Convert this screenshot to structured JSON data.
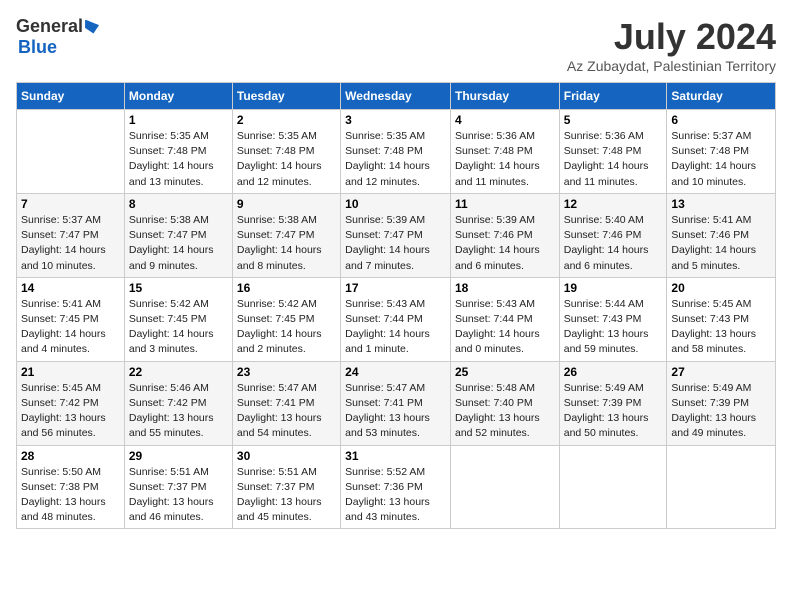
{
  "header": {
    "logo_general": "General",
    "logo_blue": "Blue",
    "month": "July 2024",
    "location": "Az Zubaydat, Palestinian Territory"
  },
  "weekdays": [
    "Sunday",
    "Monday",
    "Tuesday",
    "Wednesday",
    "Thursday",
    "Friday",
    "Saturday"
  ],
  "weeks": [
    [
      {
        "day": "",
        "sunrise": "",
        "sunset": "",
        "daylight": ""
      },
      {
        "day": "1",
        "sunrise": "Sunrise: 5:35 AM",
        "sunset": "Sunset: 7:48 PM",
        "daylight": "Daylight: 14 hours and 13 minutes."
      },
      {
        "day": "2",
        "sunrise": "Sunrise: 5:35 AM",
        "sunset": "Sunset: 7:48 PM",
        "daylight": "Daylight: 14 hours and 12 minutes."
      },
      {
        "day": "3",
        "sunrise": "Sunrise: 5:35 AM",
        "sunset": "Sunset: 7:48 PM",
        "daylight": "Daylight: 14 hours and 12 minutes."
      },
      {
        "day": "4",
        "sunrise": "Sunrise: 5:36 AM",
        "sunset": "Sunset: 7:48 PM",
        "daylight": "Daylight: 14 hours and 11 minutes."
      },
      {
        "day": "5",
        "sunrise": "Sunrise: 5:36 AM",
        "sunset": "Sunset: 7:48 PM",
        "daylight": "Daylight: 14 hours and 11 minutes."
      },
      {
        "day": "6",
        "sunrise": "Sunrise: 5:37 AM",
        "sunset": "Sunset: 7:48 PM",
        "daylight": "Daylight: 14 hours and 10 minutes."
      }
    ],
    [
      {
        "day": "7",
        "sunrise": "Sunrise: 5:37 AM",
        "sunset": "Sunset: 7:47 PM",
        "daylight": "Daylight: 14 hours and 10 minutes."
      },
      {
        "day": "8",
        "sunrise": "Sunrise: 5:38 AM",
        "sunset": "Sunset: 7:47 PM",
        "daylight": "Daylight: 14 hours and 9 minutes."
      },
      {
        "day": "9",
        "sunrise": "Sunrise: 5:38 AM",
        "sunset": "Sunset: 7:47 PM",
        "daylight": "Daylight: 14 hours and 8 minutes."
      },
      {
        "day": "10",
        "sunrise": "Sunrise: 5:39 AM",
        "sunset": "Sunset: 7:47 PM",
        "daylight": "Daylight: 14 hours and 7 minutes."
      },
      {
        "day": "11",
        "sunrise": "Sunrise: 5:39 AM",
        "sunset": "Sunset: 7:46 PM",
        "daylight": "Daylight: 14 hours and 6 minutes."
      },
      {
        "day": "12",
        "sunrise": "Sunrise: 5:40 AM",
        "sunset": "Sunset: 7:46 PM",
        "daylight": "Daylight: 14 hours and 6 minutes."
      },
      {
        "day": "13",
        "sunrise": "Sunrise: 5:41 AM",
        "sunset": "Sunset: 7:46 PM",
        "daylight": "Daylight: 14 hours and 5 minutes."
      }
    ],
    [
      {
        "day": "14",
        "sunrise": "Sunrise: 5:41 AM",
        "sunset": "Sunset: 7:45 PM",
        "daylight": "Daylight: 14 hours and 4 minutes."
      },
      {
        "day": "15",
        "sunrise": "Sunrise: 5:42 AM",
        "sunset": "Sunset: 7:45 PM",
        "daylight": "Daylight: 14 hours and 3 minutes."
      },
      {
        "day": "16",
        "sunrise": "Sunrise: 5:42 AM",
        "sunset": "Sunset: 7:45 PM",
        "daylight": "Daylight: 14 hours and 2 minutes."
      },
      {
        "day": "17",
        "sunrise": "Sunrise: 5:43 AM",
        "sunset": "Sunset: 7:44 PM",
        "daylight": "Daylight: 14 hours and 1 minute."
      },
      {
        "day": "18",
        "sunrise": "Sunrise: 5:43 AM",
        "sunset": "Sunset: 7:44 PM",
        "daylight": "Daylight: 14 hours and 0 minutes."
      },
      {
        "day": "19",
        "sunrise": "Sunrise: 5:44 AM",
        "sunset": "Sunset: 7:43 PM",
        "daylight": "Daylight: 13 hours and 59 minutes."
      },
      {
        "day": "20",
        "sunrise": "Sunrise: 5:45 AM",
        "sunset": "Sunset: 7:43 PM",
        "daylight": "Daylight: 13 hours and 58 minutes."
      }
    ],
    [
      {
        "day": "21",
        "sunrise": "Sunrise: 5:45 AM",
        "sunset": "Sunset: 7:42 PM",
        "daylight": "Daylight: 13 hours and 56 minutes."
      },
      {
        "day": "22",
        "sunrise": "Sunrise: 5:46 AM",
        "sunset": "Sunset: 7:42 PM",
        "daylight": "Daylight: 13 hours and 55 minutes."
      },
      {
        "day": "23",
        "sunrise": "Sunrise: 5:47 AM",
        "sunset": "Sunset: 7:41 PM",
        "daylight": "Daylight: 13 hours and 54 minutes."
      },
      {
        "day": "24",
        "sunrise": "Sunrise: 5:47 AM",
        "sunset": "Sunset: 7:41 PM",
        "daylight": "Daylight: 13 hours and 53 minutes."
      },
      {
        "day": "25",
        "sunrise": "Sunrise: 5:48 AM",
        "sunset": "Sunset: 7:40 PM",
        "daylight": "Daylight: 13 hours and 52 minutes."
      },
      {
        "day": "26",
        "sunrise": "Sunrise: 5:49 AM",
        "sunset": "Sunset: 7:39 PM",
        "daylight": "Daylight: 13 hours and 50 minutes."
      },
      {
        "day": "27",
        "sunrise": "Sunrise: 5:49 AM",
        "sunset": "Sunset: 7:39 PM",
        "daylight": "Daylight: 13 hours and 49 minutes."
      }
    ],
    [
      {
        "day": "28",
        "sunrise": "Sunrise: 5:50 AM",
        "sunset": "Sunset: 7:38 PM",
        "daylight": "Daylight: 13 hours and 48 minutes."
      },
      {
        "day": "29",
        "sunrise": "Sunrise: 5:51 AM",
        "sunset": "Sunset: 7:37 PM",
        "daylight": "Daylight: 13 hours and 46 minutes."
      },
      {
        "day": "30",
        "sunrise": "Sunrise: 5:51 AM",
        "sunset": "Sunset: 7:37 PM",
        "daylight": "Daylight: 13 hours and 45 minutes."
      },
      {
        "day": "31",
        "sunrise": "Sunrise: 5:52 AM",
        "sunset": "Sunset: 7:36 PM",
        "daylight": "Daylight: 13 hours and 43 minutes."
      },
      {
        "day": "",
        "sunrise": "",
        "sunset": "",
        "daylight": ""
      },
      {
        "day": "",
        "sunrise": "",
        "sunset": "",
        "daylight": ""
      },
      {
        "day": "",
        "sunrise": "",
        "sunset": "",
        "daylight": ""
      }
    ]
  ]
}
